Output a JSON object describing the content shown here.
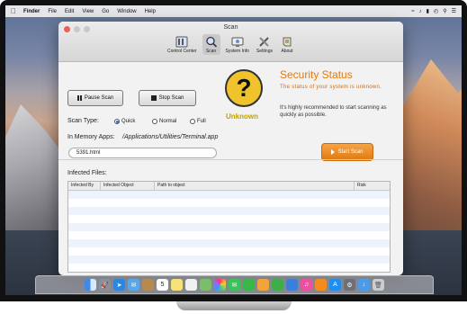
{
  "menubar": {
    "apple_icon": "apple-icon",
    "items": [
      "Finder",
      "File",
      "Edit",
      "View",
      "Go",
      "Window",
      "Help"
    ],
    "status_icons": [
      "wifi-icon",
      "volume-icon",
      "battery-icon",
      "clock-icon",
      "spotlight-icon",
      "list-icon"
    ]
  },
  "window": {
    "title": "Scan",
    "toolbar": [
      {
        "label": "Control Center",
        "icon": "control-center-icon",
        "active": false
      },
      {
        "label": "Scan",
        "icon": "scan-icon",
        "active": true
      },
      {
        "label": "System Info",
        "icon": "system-info-icon",
        "active": false
      },
      {
        "label": "Settings",
        "icon": "settings-icon",
        "active": false
      },
      {
        "label": "About",
        "icon": "about-icon",
        "active": false
      }
    ]
  },
  "controls": {
    "pause_label": "Pause Scan",
    "stop_label": "Stop Scan",
    "scan_type_label": "Scan Type:",
    "options": [
      {
        "label": "Quick",
        "selected": true
      },
      {
        "label": "Normal",
        "selected": false
      },
      {
        "label": "Full",
        "selected": false
      }
    ],
    "memory_label": "In Memory Apps:",
    "memory_value": "/Applications/Utilities/Terminal.app",
    "current_file": "5391.html"
  },
  "status": {
    "icon_glyph": "?",
    "icon": "question-mark-icon",
    "state": "Unknown",
    "title": "Security Status",
    "message": "The status of your system is unknown.",
    "advice": "It's highly recommended to start scanning as quickly as possible.",
    "start_label": "Start Scan"
  },
  "infected": {
    "label": "Infected Files:",
    "columns": [
      "Infected By",
      "Infected Object",
      "Path to object",
      "Risk"
    ],
    "rows": []
  },
  "colors": {
    "accent_orange": "#e07b13",
    "status_yellow": "#f0c22c",
    "radio_blue": "#2c6ad6"
  },
  "dock": {
    "icons": [
      "finder-icon",
      "launchpad-icon",
      "safari-icon",
      "mail-icon",
      "contacts-icon",
      "calendar-icon",
      "notes-icon",
      "reminders-icon",
      "maps-icon",
      "photos-icon",
      "messages-icon",
      "facetime-icon",
      "pages-icon",
      "numbers-icon",
      "keynote-icon",
      "itunes-icon",
      "ibooks-icon",
      "app-store-icon",
      "system-preferences-icon",
      "downloads-icon",
      "trash-icon"
    ],
    "calendar_day": "5"
  }
}
